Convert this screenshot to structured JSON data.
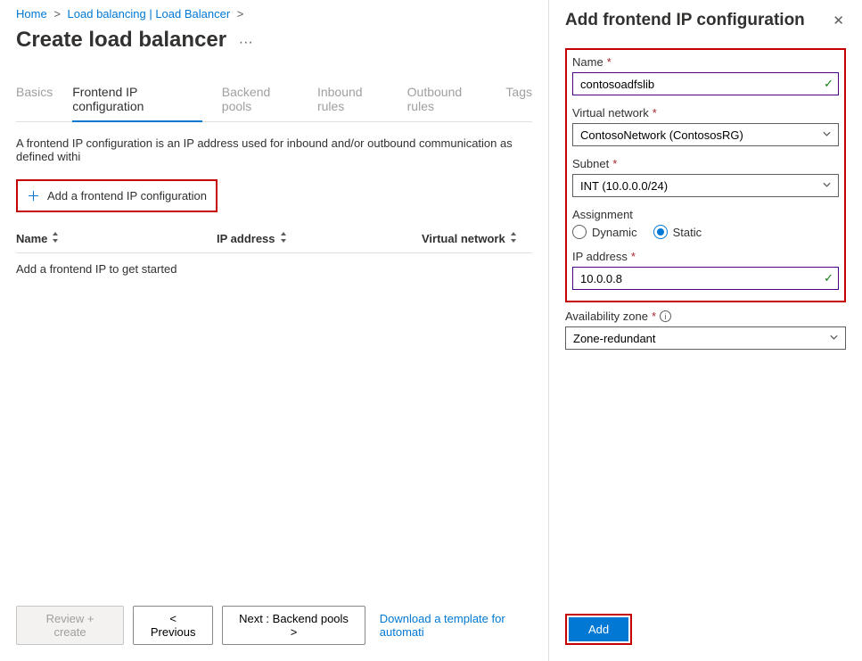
{
  "breadcrumb": {
    "home": "Home",
    "lb_list": "Load balancing | Load Balancer"
  },
  "page": {
    "title": "Create load balancer",
    "more": "···"
  },
  "tabs": {
    "basics": "Basics",
    "frontend": "Frontend IP configuration",
    "backend": "Backend pools",
    "inbound": "Inbound rules",
    "outbound": "Outbound rules",
    "tags": "Tags"
  },
  "description": "A frontend IP configuration is an IP address used for inbound and/or outbound communication as defined withi",
  "add_button": "Add a frontend IP configuration",
  "table": {
    "col_name": "Name",
    "col_ip": "IP address",
    "col_vnet": "Virtual network",
    "empty_row": "Add a frontend IP to get started"
  },
  "footer": {
    "review": "Review + create",
    "previous": "< Previous",
    "next": "Next : Backend pools >",
    "template_link": "Download a template for automati"
  },
  "panel": {
    "title": "Add frontend IP configuration",
    "fields": {
      "name_label": "Name",
      "name_value": "contosoadfslib",
      "vnet_label": "Virtual network",
      "vnet_value": "ContosoNetwork (ContososRG)",
      "subnet_label": "Subnet",
      "subnet_value": "INT (10.0.0.0/24)",
      "assignment_label": "Assignment",
      "dynamic": "Dynamic",
      "static": "Static",
      "ip_label": "IP address",
      "ip_value": "10.0.0.8",
      "zone_label": "Availability zone",
      "zone_value": "Zone-redundant"
    },
    "add": "Add"
  }
}
